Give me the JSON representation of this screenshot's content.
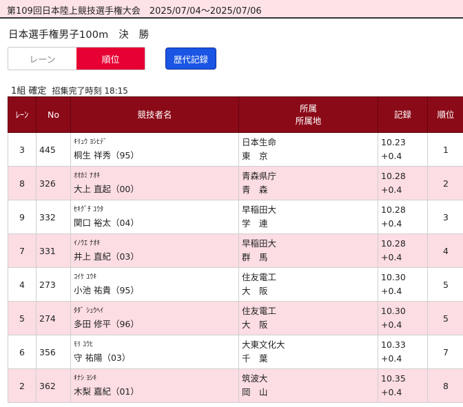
{
  "header": {
    "championship": "第109回日本陸上競技選手権大会　2025/07/04～2025/07/06"
  },
  "event": {
    "title": "日本選手権男子100m　決　勝"
  },
  "view_toggle": {
    "lane_label": "レーン",
    "rank_label": "順位"
  },
  "history_button": "歴代記録",
  "heat": {
    "status": "1組 確定",
    "call_time": "招集完了時刻 18:15"
  },
  "colors": {
    "header_bg": "#8b0a18",
    "accent_red": "#e60033",
    "row_alt": "#fbdde3",
    "button_blue": "#1a55e3"
  },
  "table": {
    "headers": {
      "lane": "ﾚｰﾝ",
      "no": "No",
      "name": "競技者名",
      "affiliation_1": "所属",
      "affiliation_2": "所属地",
      "record": "記録",
      "rank": "順位"
    },
    "rows": [
      {
        "lane": "3",
        "no": "445",
        "kana": "ｷﾘｭｳ ﾖｼﾋﾃﾞ",
        "name": "桐生 祥秀（95）",
        "affiliation": "日本生命",
        "region": "東　京",
        "time": "10.23",
        "wind": "+0.4",
        "rank": "1"
      },
      {
        "lane": "8",
        "no": "326",
        "kana": "ｵｵｶﾐ ﾅｵｷ",
        "name": "大上 直起（00）",
        "affiliation": "青森県庁",
        "region": "青　森",
        "time": "10.28",
        "wind": "+0.4",
        "rank": "2"
      },
      {
        "lane": "9",
        "no": "332",
        "kana": "ｾｷｸﾞﾁ ﾕｳﾀ",
        "name": "関口 裕太（04）",
        "affiliation": "早稲田大",
        "region": "学　連",
        "time": "10.28",
        "wind": "+0.4",
        "rank": "3"
      },
      {
        "lane": "7",
        "no": "331",
        "kana": "ｲﾉｳｴ ﾅｵｷ",
        "name": "井上 直紀（03）",
        "affiliation": "早稲田大",
        "region": "群　馬",
        "time": "10.28",
        "wind": "+0.4",
        "rank": "4"
      },
      {
        "lane": "4",
        "no": "273",
        "kana": "ｺｲｹ ﾕｳｷ",
        "name": "小池 祐貴（95）",
        "affiliation": "住友電工",
        "region": "大　阪",
        "time": "10.30",
        "wind": "+0.4",
        "rank": "5"
      },
      {
        "lane": "5",
        "no": "274",
        "kana": "ﾀﾀﾞ ｼｭｳﾍｲ",
        "name": "多田 修平（96）",
        "affiliation": "住友電工",
        "region": "大　阪",
        "time": "10.30",
        "wind": "+0.4",
        "rank": "5"
      },
      {
        "lane": "6",
        "no": "356",
        "kana": "ﾓﾘ ﾕｳﾋ",
        "name": "守 祐陽（03）",
        "affiliation": "大東文化大",
        "region": "千　葉",
        "time": "10.33",
        "wind": "+0.4",
        "rank": "7"
      },
      {
        "lane": "2",
        "no": "362",
        "kana": "ｷﾅｼ ﾖｼｷ",
        "name": "木梨 嘉紀（01）",
        "affiliation": "筑波大",
        "region": "岡　山",
        "time": "10.35",
        "wind": "+0.4",
        "rank": "8"
      }
    ]
  }
}
